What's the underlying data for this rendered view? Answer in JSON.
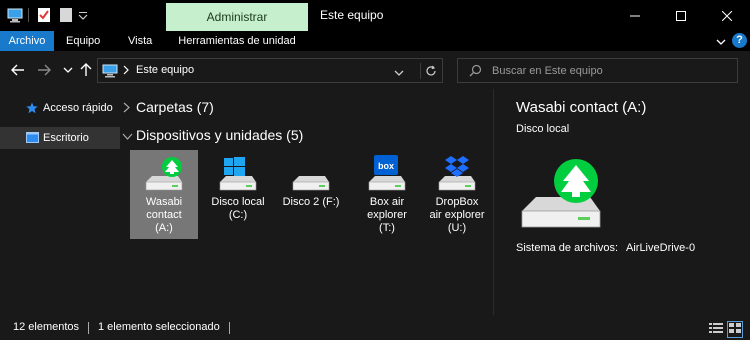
{
  "window": {
    "title": "Este equipo",
    "contextual_tab": "Administrar",
    "controls": {
      "minimize": "minimize-icon",
      "maximize": "maximize-icon",
      "close": "close-icon"
    }
  },
  "ribbon": {
    "tabs": [
      "Archivo",
      "Equipo",
      "Vista",
      "Herramientas de unidad"
    ],
    "active_tab": "Archivo",
    "help": "?"
  },
  "address_bar": {
    "path": "Este equipo",
    "search_placeholder": "Buscar en Este equipo"
  },
  "nav_pane": {
    "items": [
      {
        "label": "Acceso rápido",
        "icon": "star-icon"
      },
      {
        "label": "Escritorio",
        "icon": "desktop-icon",
        "selected": true
      }
    ]
  },
  "content": {
    "groups": [
      {
        "label": "Carpetas (7)",
        "expanded": false
      },
      {
        "label": "Dispositivos y unidades (5)",
        "expanded": true
      }
    ],
    "drives": [
      {
        "name": "Wasabi contact (A:)",
        "lines": [
          "Wasabi",
          "contact",
          "(A:)"
        ],
        "icon": "wasabi-drive-icon",
        "selected": true
      },
      {
        "name": "Disco local (C:)",
        "lines": [
          "Disco local",
          "(C:)"
        ],
        "icon": "windows-drive-icon",
        "selected": false
      },
      {
        "name": "Disco 2 (F:)",
        "lines": [
          "Disco 2 (F:)"
        ],
        "icon": "hard-drive-icon",
        "selected": false
      },
      {
        "name": "Box air explorer (T:)",
        "lines": [
          "Box air",
          "explorer",
          "(T:)"
        ],
        "icon": "box-drive-icon",
        "selected": false
      },
      {
        "name": "DropBox air explorer (U:)",
        "lines": [
          "DropBox",
          "air explorer",
          "(U:)"
        ],
        "icon": "dropbox-drive-icon",
        "selected": false
      }
    ]
  },
  "details": {
    "title": "Wasabi contact (A:)",
    "subtitle": "Disco local",
    "filesystem_label": "Sistema de archivos:",
    "filesystem_value": "AirLiveDrive-0"
  },
  "status": {
    "count": "12 elementos",
    "selection": "1 elemento seleccionado"
  },
  "colors": {
    "accent": "#1979ca",
    "contextual_tab_bg": "#c6efce",
    "wasabi_green": "#00ce3e",
    "box_blue": "#0061d5",
    "dropbox_blue": "#0061fe",
    "selection_bg": "#777777"
  }
}
